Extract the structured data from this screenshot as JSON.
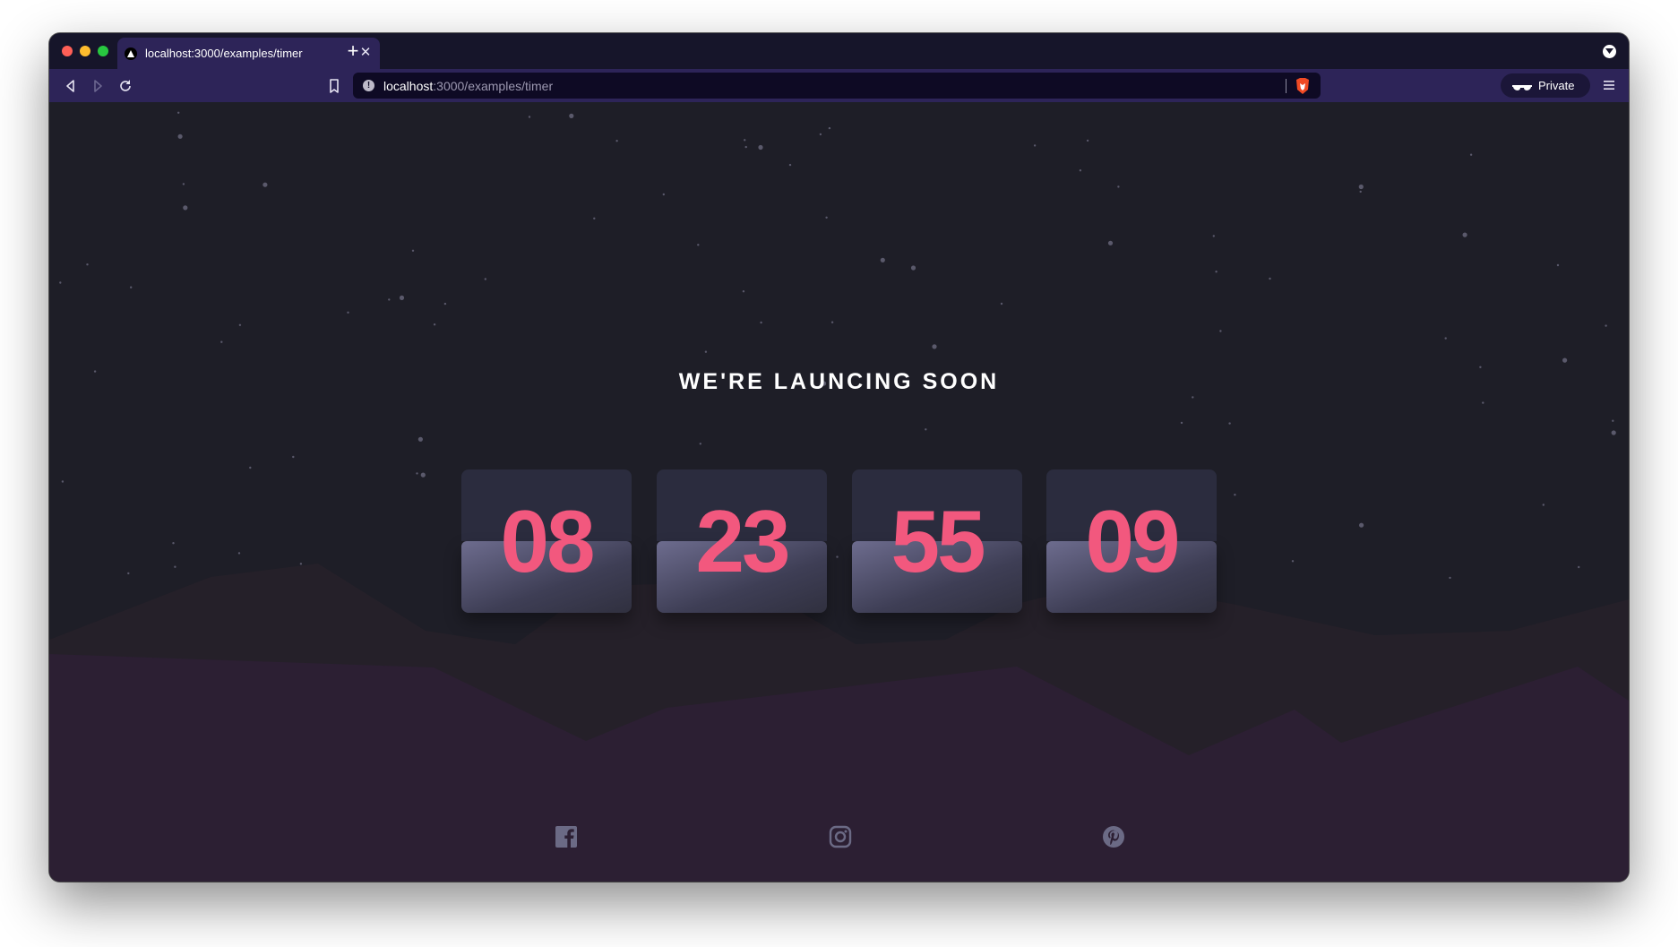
{
  "browser": {
    "tab_title": "localhost:3000/examples/timer",
    "url_host": "localhost",
    "url_path": ":3000/examples/timer",
    "private_label": "Private"
  },
  "page": {
    "heading": "WE'RE LAUNCING SOON",
    "countdown": [
      {
        "value": "08"
      },
      {
        "value": "23"
      },
      {
        "value": "55"
      },
      {
        "value": "09"
      }
    ],
    "social": [
      "facebook-icon",
      "instagram-icon",
      "pinterest-icon"
    ]
  },
  "colors": {
    "chrome_dark": "#16152a",
    "chrome_purple": "#2d2458",
    "page_background": "#1e1e27",
    "countdown_number": "#f2587e",
    "hills": "#2c1f33",
    "social_icon": "#6b6a85"
  }
}
